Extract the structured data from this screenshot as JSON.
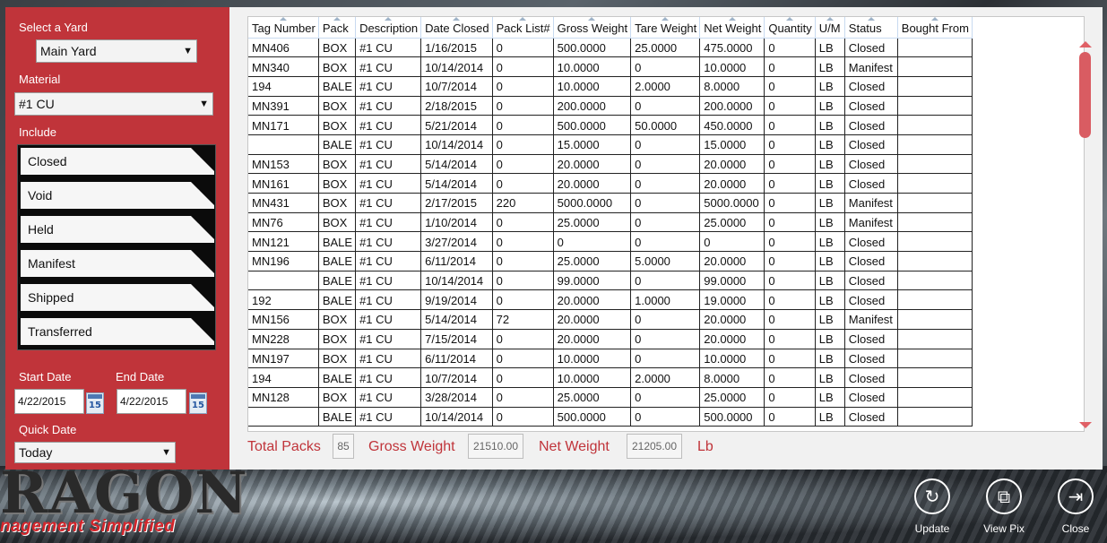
{
  "brand": {
    "word": "RAGON",
    "tagline": "nagement Simplified"
  },
  "filters": {
    "yard_label": "Select a Yard",
    "yard_value": "Main Yard",
    "material_label": "Material",
    "material_value": "#1 CU",
    "include_label": "Include",
    "include_items": [
      "Closed",
      "Void",
      "Held",
      "Manifest",
      "Shipped",
      "Transferred"
    ],
    "start_date_label": "Start Date",
    "start_date": "4/22/2015",
    "end_date_label": "End Date",
    "end_date": "4/22/2015",
    "calendar_day": "15",
    "quick_date_label": "Quick Date",
    "quick_date_value": "Today"
  },
  "table": {
    "columns": [
      "Tag Number",
      "Pack",
      "Description",
      "Date Closed",
      "Pack List#",
      "Gross Weight",
      "Tare Weight",
      "Net Weight",
      "Quantity",
      "U/M",
      "Status",
      "Bought From"
    ],
    "rows": [
      [
        "MN406",
        "BOX",
        "#1 CU",
        "1/16/2015",
        "0",
        "500.0000",
        "25.0000",
        "475.0000",
        "0",
        "LB",
        "Closed",
        ""
      ],
      [
        "MN340",
        "BOX",
        "#1 CU",
        "10/14/2014",
        "0",
        "10.0000",
        "0",
        "10.0000",
        "0",
        "LB",
        "Manifest",
        ""
      ],
      [
        "194",
        "BALE",
        "#1 CU",
        "10/7/2014",
        "0",
        "10.0000",
        "2.0000",
        "8.0000",
        "0",
        "LB",
        "Closed",
        ""
      ],
      [
        "MN391",
        "BOX",
        "#1 CU",
        "2/18/2015",
        "0",
        "200.0000",
        "0",
        "200.0000",
        "0",
        "LB",
        "Closed",
        ""
      ],
      [
        "MN171",
        "BOX",
        "#1 CU",
        "5/21/2014",
        "0",
        "500.0000",
        "50.0000",
        "450.0000",
        "0",
        "LB",
        "Closed",
        ""
      ],
      [
        "",
        "BALE",
        "#1 CU",
        "10/14/2014",
        "0",
        "15.0000",
        "0",
        "15.0000",
        "0",
        "LB",
        "Closed",
        ""
      ],
      [
        "MN153",
        "BOX",
        "#1 CU",
        "5/14/2014",
        "0",
        "20.0000",
        "0",
        "20.0000",
        "0",
        "LB",
        "Closed",
        ""
      ],
      [
        "MN161",
        "BOX",
        "#1 CU",
        "5/14/2014",
        "0",
        "20.0000",
        "0",
        "20.0000",
        "0",
        "LB",
        "Closed",
        ""
      ],
      [
        "MN431",
        "BOX",
        "#1 CU",
        "2/17/2015",
        "220",
        "5000.0000",
        "0",
        "5000.0000",
        "0",
        "LB",
        "Manifest",
        ""
      ],
      [
        "MN76",
        "BOX",
        "#1 CU",
        "1/10/2014",
        "0",
        "25.0000",
        "0",
        "25.0000",
        "0",
        "LB",
        "Manifest",
        ""
      ],
      [
        "MN121",
        "BALE",
        "#1 CU",
        "3/27/2014",
        "0",
        "0",
        "0",
        "0",
        "0",
        "LB",
        "Closed",
        ""
      ],
      [
        "MN196",
        "BALE",
        "#1 CU",
        "6/11/2014",
        "0",
        "25.0000",
        "5.0000",
        "20.0000",
        "0",
        "LB",
        "Closed",
        ""
      ],
      [
        "",
        "BALE",
        "#1 CU",
        "10/14/2014",
        "0",
        "99.0000",
        "0",
        "99.0000",
        "0",
        "LB",
        "Closed",
        ""
      ],
      [
        "192",
        "BALE",
        "#1 CU",
        "9/19/2014",
        "0",
        "20.0000",
        "1.0000",
        "19.0000",
        "0",
        "LB",
        "Closed",
        ""
      ],
      [
        "MN156",
        "BOX",
        "#1 CU",
        "5/14/2014",
        "72",
        "20.0000",
        "0",
        "20.0000",
        "0",
        "LB",
        "Manifest",
        ""
      ],
      [
        "MN228",
        "BOX",
        "#1 CU",
        "7/15/2014",
        "0",
        "20.0000",
        "0",
        "20.0000",
        "0",
        "LB",
        "Closed",
        ""
      ],
      [
        "MN197",
        "BOX",
        "#1 CU",
        "6/11/2014",
        "0",
        "10.0000",
        "0",
        "10.0000",
        "0",
        "LB",
        "Closed",
        ""
      ],
      [
        "194",
        "BALE",
        "#1 CU",
        "10/7/2014",
        "0",
        "10.0000",
        "2.0000",
        "8.0000",
        "0",
        "LB",
        "Closed",
        ""
      ],
      [
        "MN128",
        "BOX",
        "#1 CU",
        "3/28/2014",
        "0",
        "25.0000",
        "0",
        "25.0000",
        "0",
        "LB",
        "Closed",
        ""
      ],
      [
        "",
        "BALE",
        "#1 CU",
        "10/14/2014",
        "0",
        "500.0000",
        "0",
        "500.0000",
        "0",
        "LB",
        "Closed",
        ""
      ]
    ]
  },
  "totals": {
    "total_packs_label": "Total Packs",
    "total_packs": "85",
    "gross_weight_label": "Gross Weight",
    "gross_weight": "21510.00",
    "net_weight_label": "Net Weight",
    "net_weight": "21205.00",
    "unit": "Lb"
  },
  "actions": {
    "update_label": "Update",
    "update_icon": "refresh-icon",
    "viewpix_label": "View Pix",
    "viewpix_icon": "copy-icon",
    "close_label": "Close",
    "close_icon": "exit-icon"
  },
  "colors": {
    "accent_red": "#c0343a",
    "panel_bg": "#f1f1f1"
  }
}
